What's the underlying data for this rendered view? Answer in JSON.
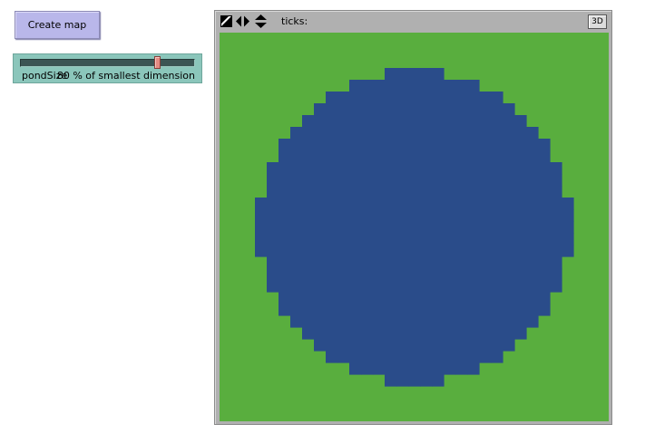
{
  "create_button": {
    "label": "Create map"
  },
  "slider": {
    "name": "pondSize",
    "value_text": "80 % of smallest dimension",
    "value": 80,
    "min": 0,
    "max": 100
  },
  "view": {
    "ticks_label": "ticks:",
    "ticks_value": "",
    "btn_3d": "3D",
    "icons": [
      "wrap-both-icon",
      "wrap-horizontal-icon",
      "wrap-vertical-icon"
    ]
  },
  "world": {
    "grid_cells": 33,
    "pond_fraction": 0.8,
    "land_color": "#59ae3e",
    "water_color": "#2a4c8a"
  },
  "colors": {
    "button_bg": "#b9b7ea",
    "slider_bg": "#8bc6bb",
    "view_bg": "#b0b0b0"
  }
}
